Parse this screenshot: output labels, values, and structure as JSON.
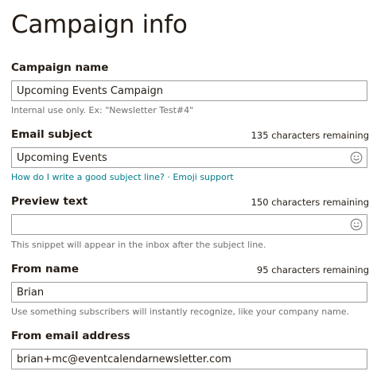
{
  "page": {
    "title": "Campaign info"
  },
  "campaign_name": {
    "label": "Campaign name",
    "value": "Upcoming Events Campaign",
    "help": "Internal use only. Ex: \"Newsletter Test#4\""
  },
  "email_subject": {
    "label": "Email subject",
    "remaining": "135 characters remaining",
    "value": "Upcoming Events",
    "link_subject_help": "How do I write a good subject line?",
    "link_separator": "·",
    "link_emoji_support": "Emoji support",
    "icon": "emoji-smiley-icon"
  },
  "preview_text": {
    "label": "Preview text",
    "remaining": "150 characters remaining",
    "value": "",
    "help": "This snippet will appear in the inbox after the subject line.",
    "icon": "emoji-smiley-icon"
  },
  "from_name": {
    "label": "From name",
    "remaining": "95 characters remaining",
    "value": "Brian",
    "help": "Use something subscribers will instantly recognize, like your company name."
  },
  "from_email": {
    "label": "From email address",
    "value": "brian+mc@eventcalendarnewsletter.com"
  }
}
